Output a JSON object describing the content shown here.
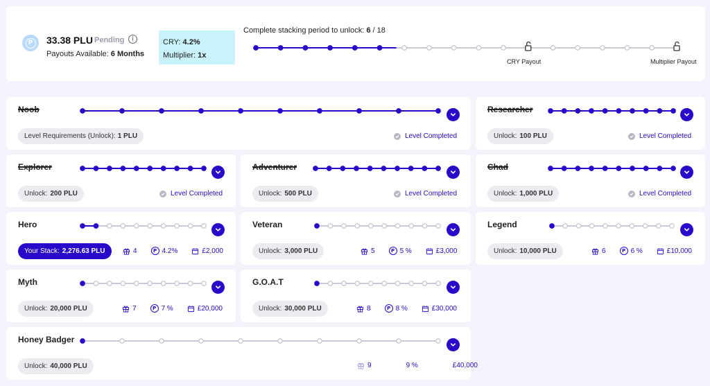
{
  "header": {
    "amount": "33.38 PLU",
    "pending": "Pending",
    "info_icon": "info-icon",
    "coin_icon": "plu-coin-icon",
    "coin_glyph": "P",
    "payouts_label": "Payouts Available:",
    "payouts_value": "6 Months",
    "cry_label": "CRY:",
    "cry_value": "4.2%",
    "multiplier_label": "Multiplier:",
    "multiplier_value": "1x",
    "stacking_label": "Complete stacking period to unlock:",
    "stacking_value": "6",
    "stacking_total": "/ 18",
    "stacking_completed_steps": 6,
    "stacking_total_steps": 18,
    "cry_payout_label": "CRY Payout",
    "multiplier_payout_label": "Multiplier Payout",
    "unlock_icon": "unlock-icon"
  },
  "colors": {
    "accent": "#2a08c9",
    "track_inactive": "#c9c9d6",
    "track_active": "#2a08c9",
    "cry_box": "#c9f3fb"
  },
  "levels": {
    "noob": {
      "title": "Noob",
      "requirement_label": "Level Requirements (Unlock):",
      "requirement_value": "1 PLU",
      "status": "Level Completed",
      "progress_steps": 10,
      "total_steps": 10
    },
    "researcher": {
      "title": "Researcher",
      "requirement_label": "Unlock:",
      "requirement_value": "100 PLU",
      "status": "Level Completed",
      "progress_steps": 10,
      "total_steps": 10
    },
    "explorer": {
      "title": "Explorer",
      "requirement_label": "Unlock:",
      "requirement_value": "200 PLU",
      "status": "Level Completed",
      "progress_steps": 10,
      "total_steps": 10
    },
    "adventurer": {
      "title": "Adventurer",
      "requirement_label": "Unlock:",
      "requirement_value": "500 PLU",
      "status": "Level Completed",
      "progress_steps": 10,
      "total_steps": 10
    },
    "chad": {
      "title": "Chad",
      "requirement_label": "Unlock:",
      "requirement_value": "1,000 PLU",
      "status": "Level Completed",
      "progress_steps": 10,
      "total_steps": 10
    },
    "hero": {
      "title": "Hero",
      "requirement_label": "Your Stack:",
      "requirement_value": "2,276.63 PLU",
      "gifts": "4",
      "cry": "4.2%",
      "cashback": "£2,000",
      "progress_steps": 2,
      "total_steps": 10
    },
    "veteran": {
      "title": "Veteran",
      "requirement_label": "Unlock:",
      "requirement_value": "3,000 PLU",
      "gifts": "5",
      "cry": "5 %",
      "cashback": "£3,000",
      "progress_steps": 1,
      "total_steps": 10
    },
    "legend": {
      "title": "Legend",
      "requirement_label": "Unlock:",
      "requirement_value": "10,000 PLU",
      "gifts": "6",
      "cry": "6 %",
      "cashback": "£10,000",
      "progress_steps": 1,
      "total_steps": 10
    },
    "myth": {
      "title": "Myth",
      "requirement_label": "Unlock:",
      "requirement_value": "20,000 PLU",
      "gifts": "7",
      "cry": "7 %",
      "cashback": "£20,000",
      "progress_steps": 1,
      "total_steps": 10
    },
    "goat": {
      "title": "G.O.A.T",
      "requirement_label": "Unlock:",
      "requirement_value": "30,000 PLU",
      "gifts": "8",
      "cry": "8 %",
      "cashback": "£30,000",
      "progress_steps": 1,
      "total_steps": 10
    },
    "honey_badger": {
      "title": "Honey Badger",
      "requirement_label": "Unlock:",
      "requirement_value": "40,000 PLU",
      "gifts": "9",
      "cry": "9 %",
      "cashback": "£40,000",
      "progress_steps": 1,
      "total_steps": 10
    }
  },
  "icons": {
    "gift": "gift-icon",
    "cry": "plu-rewards-icon",
    "cashback": "card-icon",
    "check": "check-circle-icon",
    "chevron": "chevron-down-icon"
  }
}
